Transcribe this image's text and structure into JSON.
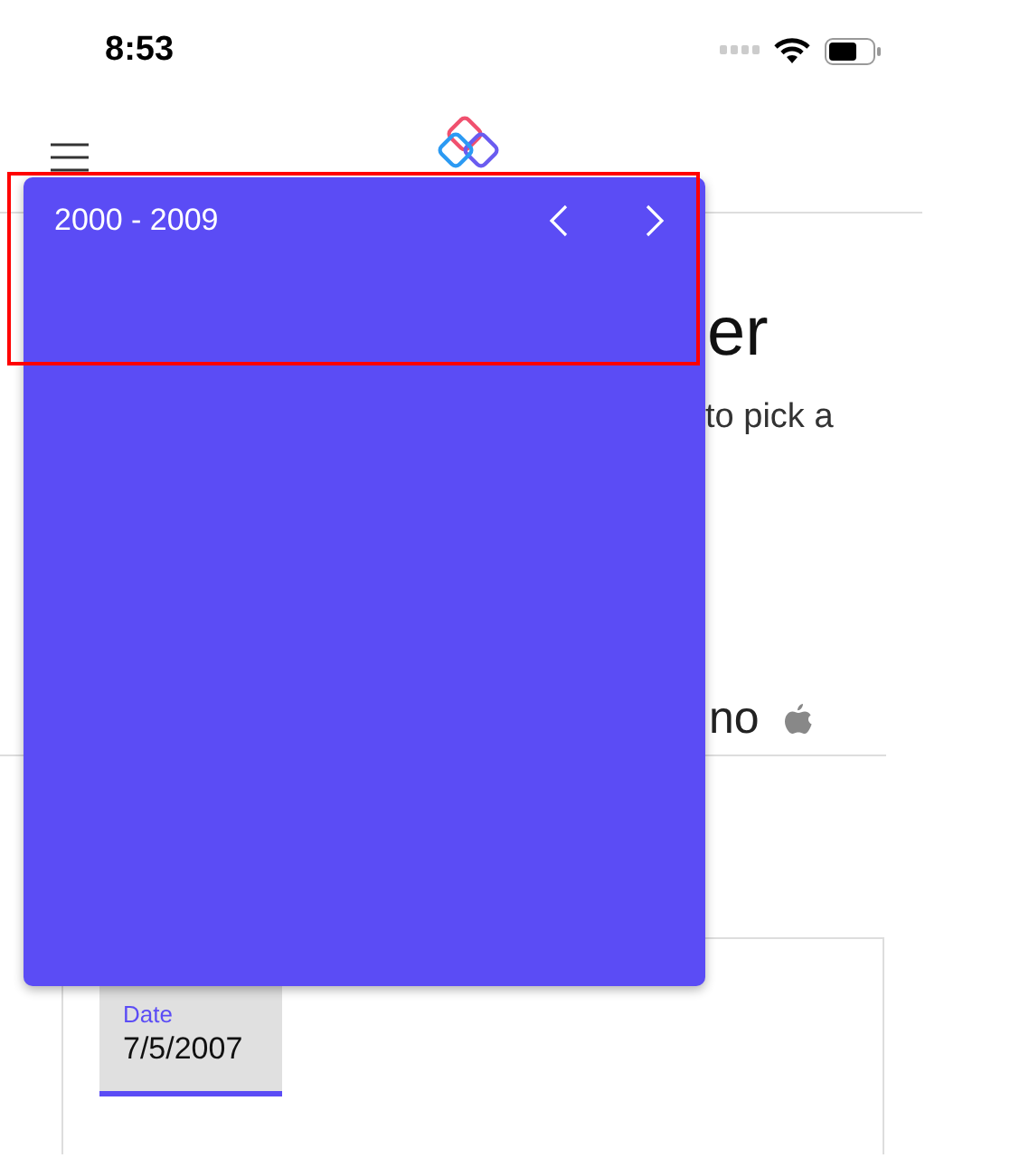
{
  "status_bar": {
    "time": "8:53"
  },
  "page": {
    "title_fragment": "er",
    "description_fragment": "to pick a",
    "platform_fragment": "no"
  },
  "date_field": {
    "label": "Date",
    "value": "7/5/2007"
  },
  "picker_popup": {
    "range": "2000 - 2009",
    "highlighted": true
  }
}
